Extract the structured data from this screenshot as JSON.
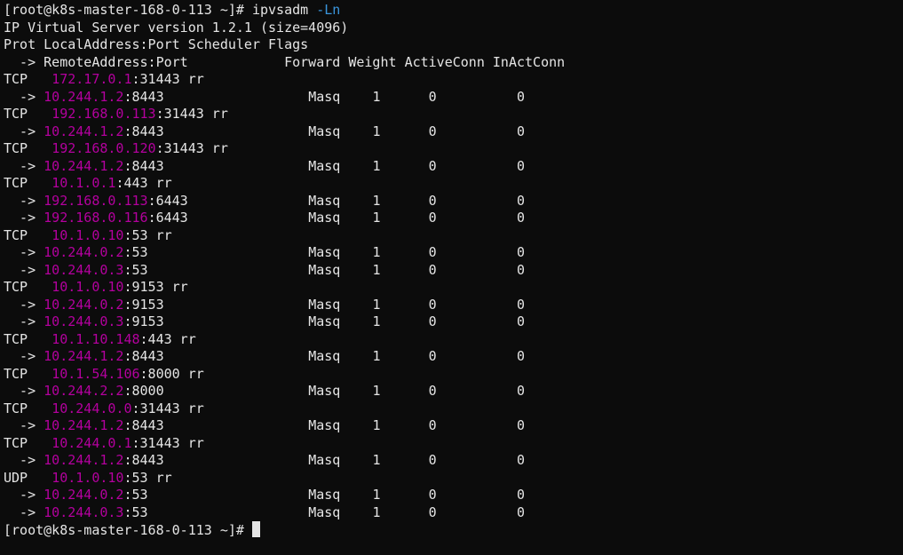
{
  "prompt1": "[root@k8s-master-168-0-113 ~]# ",
  "command": "ipvsadm ",
  "flags": "-Ln",
  "version_line": "IP Virtual Server version 1.2.1 (size=4096)",
  "hdr1": "Prot LocalAddress:Port Scheduler Flags",
  "hdr2_arrow": "  -> ",
  "hdr2_remote": "RemoteAddress:Port            ",
  "hdr2_fwd": "Forward ",
  "hdr2_wt": "Weight ",
  "hdr2_ac": "ActiveConn ",
  "hdr2_ic": "InActConn",
  "entries": [
    {
      "prot": "TCP",
      "vip": "172.17.0.1",
      "vport": ":31443 rr",
      "reals": [
        {
          "rip": "10.244.1.2",
          "rport": ":8443",
          "fwd": "Masq",
          "wt": "1",
          "ac": "0",
          "ic": "0"
        }
      ]
    },
    {
      "prot": "TCP",
      "vip": "192.168.0.113",
      "vport": ":31443 rr",
      "reals": [
        {
          "rip": "10.244.1.2",
          "rport": ":8443",
          "fwd": "Masq",
          "wt": "1",
          "ac": "0",
          "ic": "0"
        }
      ]
    },
    {
      "prot": "TCP",
      "vip": "192.168.0.120",
      "vport": ":31443 rr",
      "reals": [
        {
          "rip": "10.244.1.2",
          "rport": ":8443",
          "fwd": "Masq",
          "wt": "1",
          "ac": "0",
          "ic": "0"
        }
      ]
    },
    {
      "prot": "TCP",
      "vip": "10.1.0.1",
      "vport": ":443 rr",
      "reals": [
        {
          "rip": "192.168.0.113",
          "rport": ":6443",
          "fwd": "Masq",
          "wt": "1",
          "ac": "0",
          "ic": "0"
        },
        {
          "rip": "192.168.0.116",
          "rport": ":6443",
          "fwd": "Masq",
          "wt": "1",
          "ac": "0",
          "ic": "0"
        }
      ]
    },
    {
      "prot": "TCP",
      "vip": "10.1.0.10",
      "vport": ":53 rr",
      "reals": [
        {
          "rip": "10.244.0.2",
          "rport": ":53",
          "fwd": "Masq",
          "wt": "1",
          "ac": "0",
          "ic": "0"
        },
        {
          "rip": "10.244.0.3",
          "rport": ":53",
          "fwd": "Masq",
          "wt": "1",
          "ac": "0",
          "ic": "0"
        }
      ]
    },
    {
      "prot": "TCP",
      "vip": "10.1.0.10",
      "vport": ":9153 rr",
      "reals": [
        {
          "rip": "10.244.0.2",
          "rport": ":9153",
          "fwd": "Masq",
          "wt": "1",
          "ac": "0",
          "ic": "0"
        },
        {
          "rip": "10.244.0.3",
          "rport": ":9153",
          "fwd": "Masq",
          "wt": "1",
          "ac": "0",
          "ic": "0"
        }
      ]
    },
    {
      "prot": "TCP",
      "vip": "10.1.10.148",
      "vport": ":443 rr",
      "reals": [
        {
          "rip": "10.244.1.2",
          "rport": ":8443",
          "fwd": "Masq",
          "wt": "1",
          "ac": "0",
          "ic": "0"
        }
      ]
    },
    {
      "prot": "TCP",
      "vip": "10.1.54.106",
      "vport": ":8000 rr",
      "reals": [
        {
          "rip": "10.244.2.2",
          "rport": ":8000",
          "fwd": "Masq",
          "wt": "1",
          "ac": "0",
          "ic": "0"
        }
      ]
    },
    {
      "prot": "TCP",
      "vip": "10.244.0.0",
      "vport": ":31443 rr",
      "reals": [
        {
          "rip": "10.244.1.2",
          "rport": ":8443",
          "fwd": "Masq",
          "wt": "1",
          "ac": "0",
          "ic": "0"
        }
      ]
    },
    {
      "prot": "TCP",
      "vip": "10.244.0.1",
      "vport": ":31443 rr",
      "reals": [
        {
          "rip": "10.244.1.2",
          "rport": ":8443",
          "fwd": "Masq",
          "wt": "1",
          "ac": "0",
          "ic": "0"
        }
      ]
    },
    {
      "prot": "UDP",
      "vip": "10.1.0.10",
      "vport": ":53 rr",
      "reals": [
        {
          "rip": "10.244.0.2",
          "rport": ":53",
          "fwd": "Masq",
          "wt": "1",
          "ac": "0",
          "ic": "0"
        },
        {
          "rip": "10.244.0.3",
          "rport": ":53",
          "fwd": "Masq",
          "wt": "1",
          "ac": "0",
          "ic": "0"
        }
      ]
    },
    {
      "final_prompt": true
    }
  ],
  "arrow": "  -> ",
  "prompt2": "[root@k8s-master-168-0-113 ~]# "
}
